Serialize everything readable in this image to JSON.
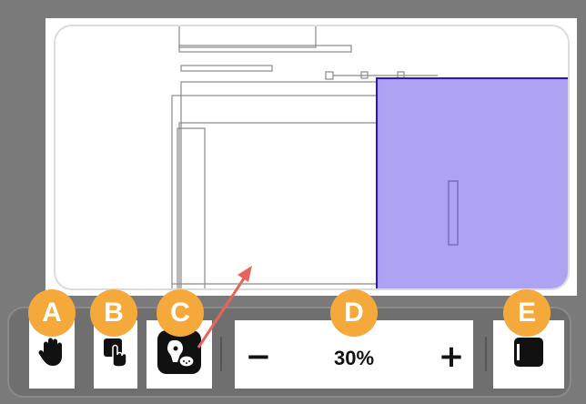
{
  "zoom": {
    "value": "30%",
    "minus_label": "−",
    "plus_label": "+"
  },
  "badges": {
    "a": "A",
    "b": "B",
    "c": "C",
    "d": "D",
    "e": "E"
  },
  "colors": {
    "badge": "#f4a93a",
    "selection_fill": "#aea3f2",
    "selection_stroke": "#2a10d8",
    "arrow": "#e8645a"
  },
  "icons": {
    "hand_tool": "hand-icon",
    "touch_tool": "touch-icon",
    "stylus_tool": "stylus-icon",
    "panel_tool": "panel-icon"
  }
}
